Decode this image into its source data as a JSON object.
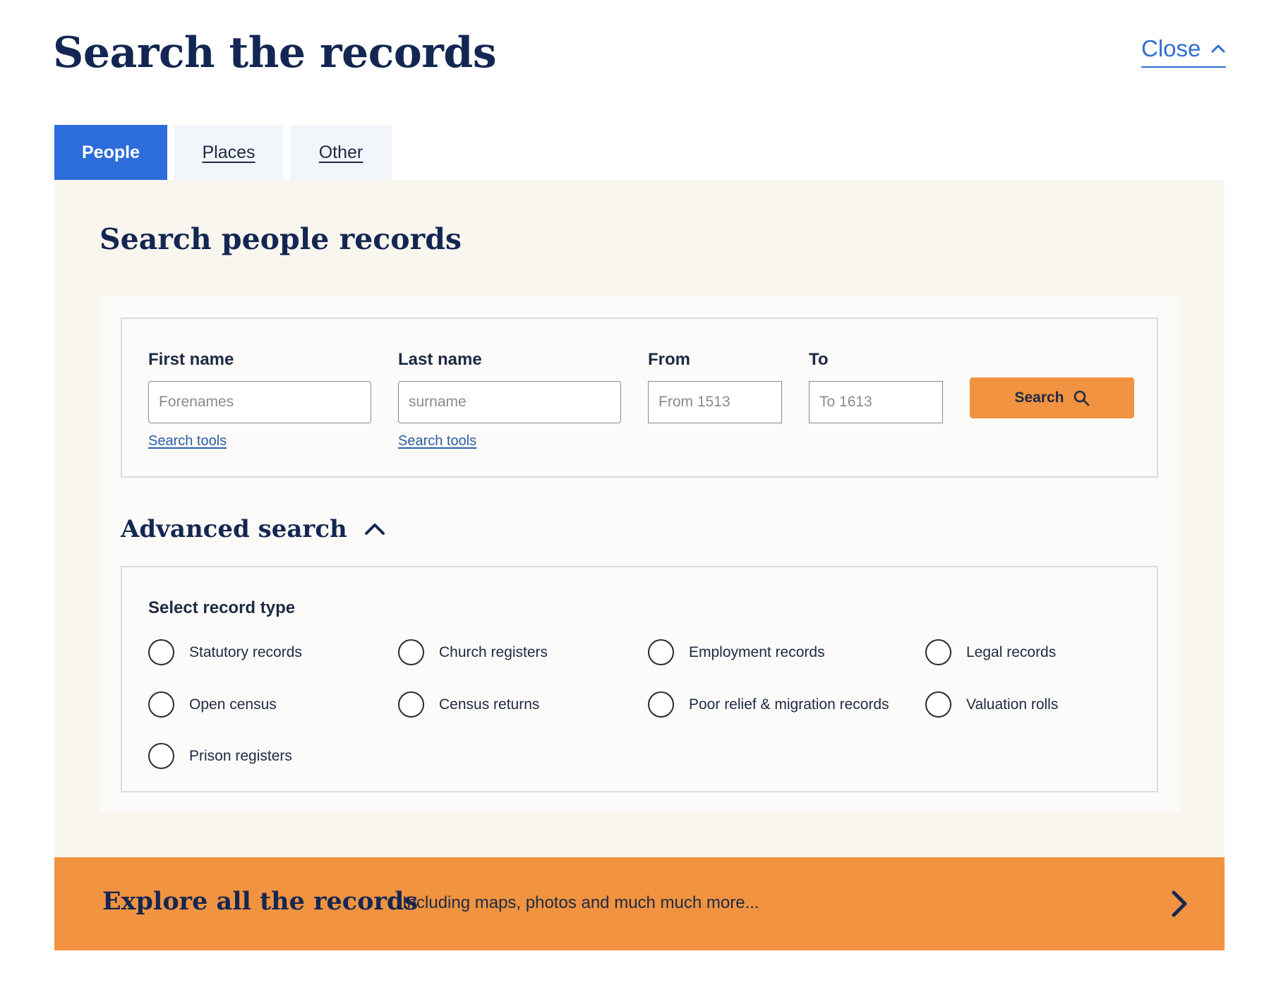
{
  "header": {
    "title": "Search the records",
    "close_label": "Close"
  },
  "tabs": [
    {
      "label": "People",
      "active": true
    },
    {
      "label": "Places",
      "active": false
    },
    {
      "label": "Other",
      "active": false
    }
  ],
  "panel": {
    "heading": "Search people records"
  },
  "fields": {
    "first_name": {
      "label": "First name",
      "placeholder": "Forenames",
      "value": "",
      "tools_link": "Search tools"
    },
    "last_name": {
      "label": "Last name",
      "placeholder": "surname",
      "value": "",
      "tools_link": "Search tools"
    },
    "from": {
      "label": "From",
      "placeholder": "From 1513",
      "value": ""
    },
    "to": {
      "label": "To",
      "placeholder": "To 1613",
      "value": ""
    }
  },
  "search_button": {
    "label": "Search",
    "icon": "search-icon"
  },
  "advanced": {
    "heading": "Advanced search",
    "icon": "chevron-up-icon",
    "record_type_label": "Select record type",
    "record_types": [
      "Statutory records",
      "Church registers",
      "Employment records",
      "Legal records",
      "Open census",
      "Census returns",
      "Poor relief & migration records",
      "Valuation rolls",
      "Prison registers"
    ]
  },
  "explore": {
    "title": "Explore all the records",
    "subtitle": "Including maps, photos and much much more...",
    "icon": "chevron-right-icon"
  },
  "colors": {
    "brand_navy": "#142752",
    "tab_active": "#2d6ddb",
    "accent_orange": "#f19340",
    "panel_bg": "#f8f6ef",
    "link_blue": "#2f6fd3"
  }
}
